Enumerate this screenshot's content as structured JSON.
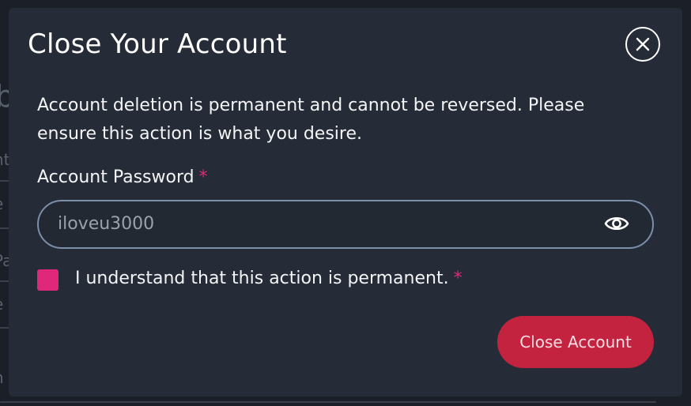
{
  "modal": {
    "title": "Close Your Account",
    "description": "Account deletion is permanent and cannot be reversed. Please ensure this action is what you desire.",
    "password_label": "Account Password",
    "required_marker": "*",
    "password_value": "iloveu3000",
    "checkbox_label": "I understand that this action is permanent.",
    "checkbox_checked": true,
    "submit_label": "Close Account",
    "close_icon": "close-circle-icon",
    "eye_icon": "eye-icon"
  },
  "colors": {
    "modal_bg": "#262c37",
    "accent_pink": "#e0287a",
    "danger_button": "#c42340",
    "input_border": "#7c8ea8"
  }
}
